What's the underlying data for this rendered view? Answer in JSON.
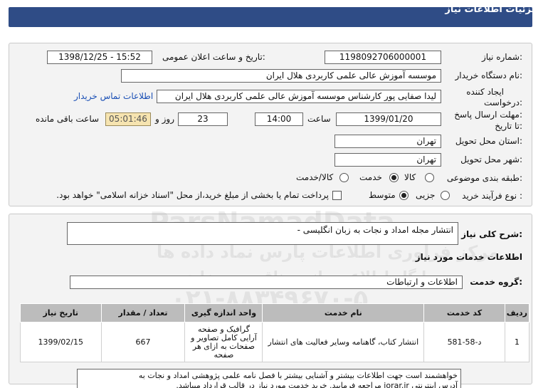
{
  "header": {
    "title": "جزئیات اطلاعات نیاز"
  },
  "form": {
    "need_number_label": "شماره نیاز:",
    "need_number": "1198092706000001",
    "announce_label": "تاریخ و ساعت اعلان عمومی:",
    "announce_value": "1398/12/25 - 15:52",
    "buyer_label": "نام دستگاه خریدار:",
    "buyer_value": "موسسه آموزش عالی علمی کاربردی هلال ایران",
    "creator_label_1": "ایجاد کننده",
    "creator_label_2": "درخواست:",
    "creator_value": "لیدا صفایی پور کارشناس موسسه آموزش عالی علمی کاربردی هلال ایران",
    "contact_link": "اطلاعات تماس خریدار",
    "deadline_label_1": "مهلت ارسال پاسخ:",
    "deadline_label_2": "تا تاریخ:",
    "deadline_date": "1399/01/20",
    "time_label": "ساعت",
    "deadline_time": "14:00",
    "days_label": "روز و",
    "days_value": "23",
    "remaining_time": "05:01:46",
    "remaining_label": "ساعت باقی مانده",
    "province_label": "استان محل تحویل:",
    "province_value": "تهران",
    "city_label": "شهر محل تحویل:",
    "city_value": "تهران",
    "category_label": "طبقه بندی موضوعی:",
    "category_options": [
      "کالا",
      "خدمت",
      "کالا/خدمت"
    ],
    "category_selected": "خدمت",
    "process_label": "نوع فرآیند خرید :",
    "process_options": [
      "جزیی",
      "متوسط"
    ],
    "process_selected": "متوسط",
    "payment_note": "پرداخت تمام یا بخشی از مبلغ خرید،از محل \"اسناد خزانه اسلامی\" خواهد بود."
  },
  "details": {
    "summary_label": "شرح کلی نیاز:",
    "summary_value": "انتشار مجله امداد و نجات به زبان انگلیسی -",
    "services_heading": "اطلاعات خدمات مورد نیاز",
    "group_label": "گروه خدمت:",
    "group_value": "اطلاعات و ارتباطات"
  },
  "table": {
    "headers": [
      "ردیف",
      "کد خدمت",
      "نام خدمت",
      "واحد اندازه گیری",
      "تعداد / مقدار",
      "تاریخ نیاز"
    ],
    "rows": [
      [
        "1",
        "د-58-581",
        "انتشار کتاب، گاهنامه وسایر فعالیت های انتشار",
        "گرافیک و صفحه آرایی کامل تصاویر و صفحات به ازای هر صفحه",
        "667",
        "1399/02/15"
      ]
    ]
  },
  "note": {
    "line1": "خواهشمند است جهت اطلاعات بیشتر و آشنایی بیشتر با فصل نامه علمی پژوهشی امداد و نجات به",
    "line2": "آدرس اینترنتی jorar.ir مراجعه فرمایید. خرید خدمت مورد نیاز در قالب قرارداد میباشد."
  },
  "watermark": {
    "line1": "ParsNamadData",
    "line2": "مرکز فراوری اطلاعات پارس نماد داده ها",
    "line3": "پایگاه اطلاع رسانی مناقصه و مزایده",
    "line4": "۰۲۱-۸۸۳۴۹۶۷۰-۵"
  },
  "colors": {
    "header_bg": "#2f4c86",
    "panel_bg": "#f3f3f3",
    "timer_bg": "#f6e4b0",
    "link": "#1a4fb5",
    "table_head": "#bcbcbc"
  }
}
